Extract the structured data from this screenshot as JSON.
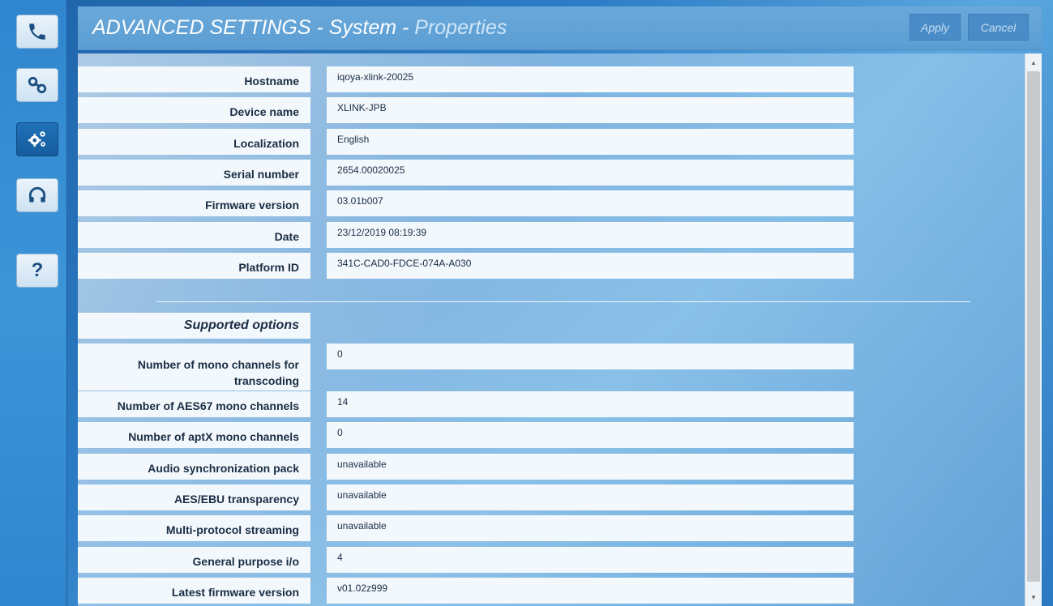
{
  "sidebar": {
    "items": [
      {
        "name": "phone",
        "label": "phone-icon"
      },
      {
        "name": "link",
        "label": "link-icon"
      },
      {
        "name": "settings",
        "label": "gears-icon"
      },
      {
        "name": "headphones",
        "label": "headphones-icon"
      },
      {
        "name": "help",
        "label": "?"
      }
    ]
  },
  "header": {
    "title_main": "ADVANCED SETTINGS - System - ",
    "title_sub": "Properties",
    "apply_label": "Apply",
    "cancel_label": "Cancel"
  },
  "properties": [
    {
      "label": "Hostname",
      "value": "iqoya-xlink-20025"
    },
    {
      "label": "Device name",
      "value": "XLINK-JPB"
    },
    {
      "label": "Localization",
      "value": "English"
    },
    {
      "label": "Serial number",
      "value": "2654.00020025"
    },
    {
      "label": "Firmware version",
      "value": "03.01b007"
    },
    {
      "label": "Date",
      "value": "23/12/2019 08:19:39"
    },
    {
      "label": "Platform ID",
      "value": "341C-CAD0-FDCE-074A-A030"
    }
  ],
  "options": {
    "title": "Supported options",
    "rows": [
      {
        "label": "Number of mono channels for transcoding",
        "value": "0"
      },
      {
        "label": "Number of AES67 mono channels",
        "value": "14"
      },
      {
        "label": "Number of aptX mono channels",
        "value": "0"
      },
      {
        "label": "Audio synchronization pack",
        "value": "unavailable"
      },
      {
        "label": "AES/EBU transparency",
        "value": "unavailable"
      },
      {
        "label": "Multi-protocol streaming",
        "value": "unavailable"
      },
      {
        "label": "General purpose i/o",
        "value": "4"
      },
      {
        "label": "Latest firmware version",
        "value": "v01.02z999"
      }
    ]
  }
}
